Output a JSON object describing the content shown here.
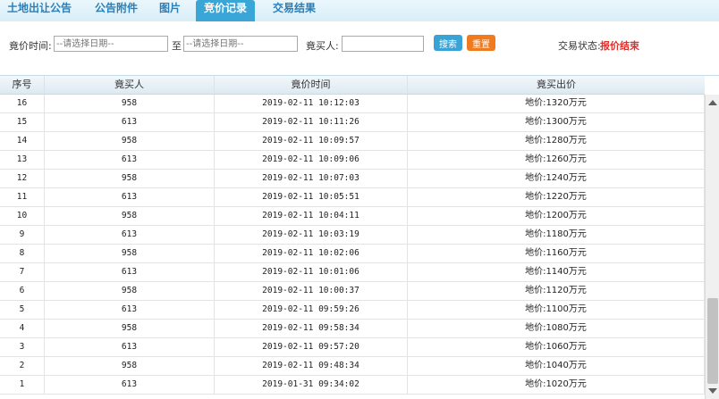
{
  "tabs": [
    {
      "label": "土地出让公告",
      "active": false
    },
    {
      "label": "公告附件",
      "active": false
    },
    {
      "label": "图片",
      "active": false
    },
    {
      "label": "竞价记录",
      "active": true
    },
    {
      "label": "交易结果",
      "active": false
    }
  ],
  "filter": {
    "bid_time_label": "竟价时间:",
    "date_from_placeholder": "--请选择日期--",
    "to_label": "至",
    "date_to_placeholder": "--请选择日期--",
    "bidder_label": "竟买人:",
    "bidder_value": "",
    "search_label": "搜索",
    "reset_label": "重置",
    "status_label": "交易状态:",
    "status_value": "报价结束"
  },
  "table": {
    "headers": [
      "序号",
      "竟买人",
      "竟价时间",
      "竟买出价"
    ],
    "rows": [
      {
        "no": "16",
        "bidder": "958",
        "time": "2019-02-11 10:12:03",
        "price": "地价:1320万元"
      },
      {
        "no": "15",
        "bidder": "613",
        "time": "2019-02-11 10:11:26",
        "price": "地价:1300万元"
      },
      {
        "no": "14",
        "bidder": "958",
        "time": "2019-02-11 10:09:57",
        "price": "地价:1280万元"
      },
      {
        "no": "13",
        "bidder": "613",
        "time": "2019-02-11 10:09:06",
        "price": "地价:1260万元"
      },
      {
        "no": "12",
        "bidder": "958",
        "time": "2019-02-11 10:07:03",
        "price": "地价:1240万元"
      },
      {
        "no": "11",
        "bidder": "613",
        "time": "2019-02-11 10:05:51",
        "price": "地价:1220万元"
      },
      {
        "no": "10",
        "bidder": "958",
        "time": "2019-02-11 10:04:11",
        "price": "地价:1200万元"
      },
      {
        "no": "9",
        "bidder": "613",
        "time": "2019-02-11 10:03:19",
        "price": "地价:1180万元"
      },
      {
        "no": "8",
        "bidder": "958",
        "time": "2019-02-11 10:02:06",
        "price": "地价:1160万元"
      },
      {
        "no": "7",
        "bidder": "613",
        "time": "2019-02-11 10:01:06",
        "price": "地价:1140万元"
      },
      {
        "no": "6",
        "bidder": "958",
        "time": "2019-02-11 10:00:37",
        "price": "地价:1120万元"
      },
      {
        "no": "5",
        "bidder": "613",
        "time": "2019-02-11 09:59:26",
        "price": "地价:1100万元"
      },
      {
        "no": "4",
        "bidder": "958",
        "time": "2019-02-11 09:58:34",
        "price": "地价:1080万元"
      },
      {
        "no": "3",
        "bidder": "613",
        "time": "2019-02-11 09:57:20",
        "price": "地价:1060万元"
      },
      {
        "no": "2",
        "bidder": "958",
        "time": "2019-02-11 09:48:34",
        "price": "地价:1040万元"
      },
      {
        "no": "1",
        "bidder": "613",
        "time": "2019-01-31 09:34:02",
        "price": "地价:1020万元"
      }
    ]
  },
  "colors": {
    "tab_text": "#2a7fb8",
    "tab_active_bg": "#3aa6d8",
    "search_button": "#3aa3d6",
    "reset_button": "#f07a1e",
    "status_value": "#e0302c"
  }
}
